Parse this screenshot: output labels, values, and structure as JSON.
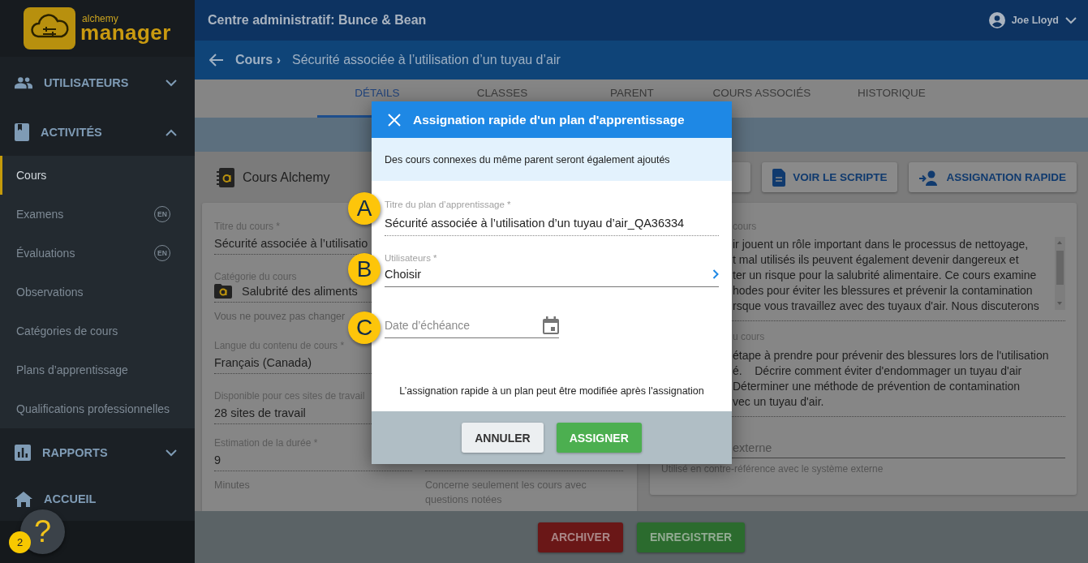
{
  "sidebar": {
    "logo": {
      "top": "alchemy",
      "bottom": "manager"
    },
    "sections": [
      {
        "label": "UTILISATEURS",
        "expanded": false
      },
      {
        "label": "ACTIVITÉS",
        "expanded": true,
        "children": [
          {
            "label": "Cours",
            "selected": true
          },
          {
            "label": "Examens",
            "selected": false,
            "badge": "EN"
          },
          {
            "label": "Évaluations",
            "selected": false,
            "badge": "EN"
          },
          {
            "label": "Observations",
            "selected": false
          },
          {
            "label": "Catégories de cours",
            "selected": false
          },
          {
            "label": "Plans d’apprentissage",
            "selected": false
          },
          {
            "label": "Qualifications professionnelles",
            "selected": false
          }
        ]
      },
      {
        "label": "RAPPORTS",
        "expanded": false
      },
      {
        "label": "ACCUEIL"
      }
    ],
    "help": {
      "label": "?",
      "badge": "2"
    }
  },
  "header": {
    "title": "Centre administratif: Bunce & Bean",
    "user": "Joe Lloyd"
  },
  "breadcrumb": {
    "parent": "Cours ›",
    "current": "Sécurité associée à l’utilisation d’un tuyau d’air"
  },
  "tabs": [
    {
      "label": "DÉTAILS",
      "selected": true
    },
    {
      "label": "CLASSES",
      "selected": false
    },
    {
      "label": "PARENT",
      "selected": false
    },
    {
      "label": "COURS ASSOCIÉS",
      "selected": false
    },
    {
      "label": "HISTORIQUE",
      "selected": false
    }
  ],
  "course_panel": {
    "heading": "Cours Alchemy",
    "fields": [
      {
        "label": "Titre du cours *",
        "value": "Sécurité associée à l’utilisatio"
      },
      {
        "label": "Catégorie du cours",
        "value": "Salubrité des aliments",
        "kind": "category",
        "hint": "Vous ne pouvez pas changer"
      },
      {
        "label": "Langue du contenu de cours *",
        "value": "Français (Canada)"
      },
      {
        "label": "Disponible pour ces sites de travail",
        "value": "28 sites de travail"
      },
      {
        "label": "Estimation de la durée *",
        "value": "9",
        "hint": "Minutes"
      }
    ],
    "side_field": {
      "hint": "Concerne seulement les cours avec questions notées"
    }
  },
  "actions": [
    {
      "label": "VOIR LE SCRIPTE"
    },
    {
      "label": "ASSIGNATION RAPIDE"
    }
  ],
  "details_panel": {
    "description": {
      "label": "cours",
      "lines": [
        "ir jouent un rôle important dans le processus de nettoyage,",
        "t mal utilisés ils peuvent également devenir dangereux et",
        "ter un risque pour la salubrité alimentaire. Ce cours examine",
        "hodes pour éviter les blessures et prévenir la contamination",
        "rsque vous travaillez avec des tuyaux d'air. Nous discuterons"
      ]
    },
    "objectives": {
      "label": "u cours",
      "lines": [
        "étape à prendre pour prévenir des blessures lors de l'utilisation",
        "é.    Décrire comment éviter d'endommager un tuyau d'air",
        "Déterminer une méthode de prévention de contamination",
        "vec un tuyau d'air."
      ]
    },
    "external_id": {
      "placeholder": "externe",
      "hint": "Utilisé en contre-référence avec le système externe"
    }
  },
  "footer_buttons": [
    {
      "label": "ARCHIVER",
      "kind": "danger"
    },
    {
      "label": "ENREGISTRER",
      "kind": "primary"
    }
  ],
  "dialog": {
    "title": "Assignation rapide d'un plan d'apprentissage",
    "notice": "Des cours connexes du même parent seront également ajoutés",
    "fields": [
      {
        "kind": "text",
        "label": "Titre du plan d’apprentissage *",
        "value": "Sécurité associée à l’utilisation d’un tuyau d’air_QA36334",
        "callout": "A"
      },
      {
        "kind": "picker",
        "label": "Utilisateurs *",
        "value": "Choisir",
        "callout": "B"
      },
      {
        "kind": "date",
        "placeholder": "Date d’échéance",
        "callout": "C"
      }
    ],
    "note": "L’assignation rapide à un plan peut être modifiée après l'assignation",
    "buttons": [
      {
        "label": "ANNULER",
        "kind": "secondary"
      },
      {
        "label": "ASSIGNER",
        "kind": "primary"
      }
    ]
  }
}
